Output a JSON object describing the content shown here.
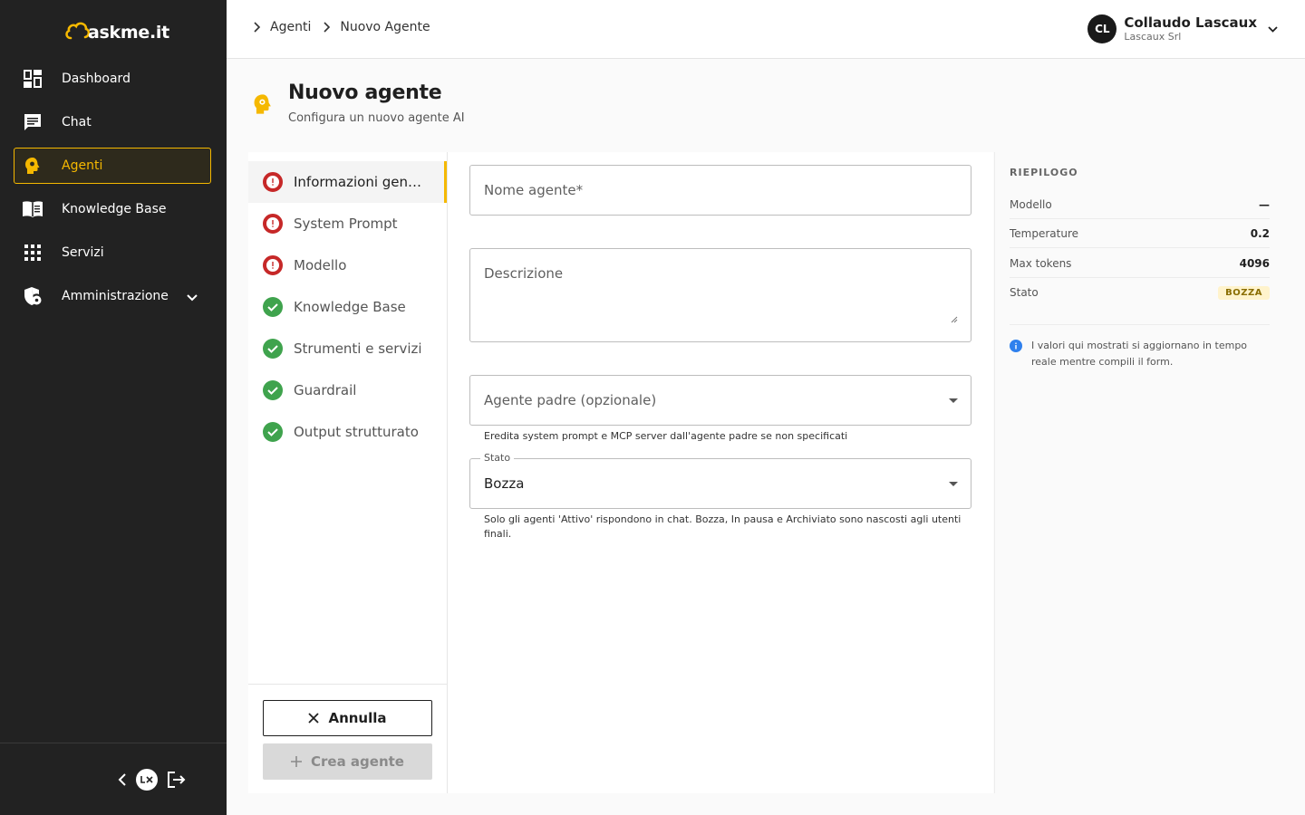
{
  "app": {
    "logo_text": "askme.it"
  },
  "sidebar": {
    "items": [
      {
        "label": "Dashboard",
        "icon": "dashboard-icon"
      },
      {
        "label": "Chat",
        "icon": "chat-icon"
      },
      {
        "label": "Agenti",
        "icon": "agent-head-icon",
        "active": true
      },
      {
        "label": "Knowledge Base",
        "icon": "book-icon"
      },
      {
        "label": "Servizi",
        "icon": "grid-icon"
      },
      {
        "label": "Amministrazione",
        "icon": "admin-shield-icon",
        "expandable": true
      }
    ],
    "footer_icons": [
      "collapse-chevron-icon",
      "lx-logo-icon",
      "logout-icon"
    ]
  },
  "header": {
    "breadcrumb": [
      "Agenti",
      "Nuovo Agente"
    ],
    "user": {
      "initials": "CL",
      "name": "Collaudo Lascaux",
      "org": "Lascaux Srl"
    }
  },
  "page": {
    "title": "Nuovo agente",
    "subtitle": "Configura un nuovo agente AI"
  },
  "steps": {
    "items": [
      {
        "label": "Informazioni generali",
        "status": "error",
        "active": true
      },
      {
        "label": "System Prompt",
        "status": "error"
      },
      {
        "label": "Modello",
        "status": "error"
      },
      {
        "label": "Knowledge Base",
        "status": "done"
      },
      {
        "label": "Strumenti e servizi",
        "status": "done"
      },
      {
        "label": "Guardrail",
        "status": "done"
      },
      {
        "label": "Output strutturato",
        "status": "done"
      }
    ],
    "cancel_label": "Annulla",
    "create_label": "Crea agente"
  },
  "form": {
    "name_placeholder": "Nome agente*",
    "description_placeholder": "Descrizione",
    "parent_placeholder": "Agente padre (opzionale)",
    "parent_helper": "Eredita system prompt e MCP server dall'agente padre se non specificati",
    "status_legend": "Stato",
    "status_value": "Bozza",
    "status_helper": "Solo gli agenti 'Attivo' rispondono in chat. Bozza, In pausa e Archiviato sono nascosti agli utenti finali."
  },
  "summary": {
    "title": "RIEPILOGO",
    "rows": [
      {
        "key": "Modello",
        "value": "—"
      },
      {
        "key": "Temperature",
        "value": "0.2"
      },
      {
        "key": "Max tokens",
        "value": "4096"
      },
      {
        "key": "Stato",
        "value": "BOZZA"
      }
    ],
    "note": "I valori qui mostrati si aggiornano in tempo reale mentre compili il form."
  },
  "colors": {
    "accent": "#f5b800",
    "sidebar_bg": "#222222",
    "error": "#c62828",
    "success": "#3fa34d"
  }
}
